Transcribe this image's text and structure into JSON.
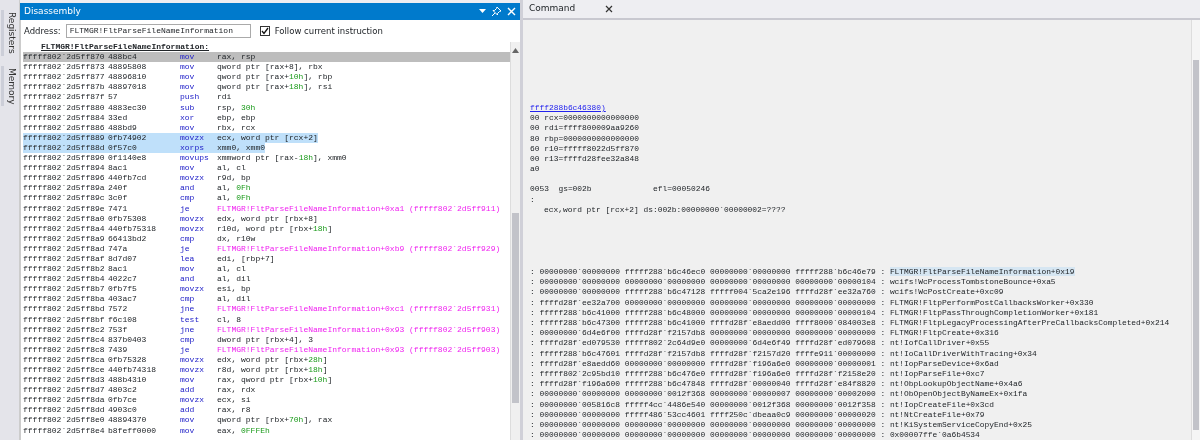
{
  "side_tabs": [
    {
      "label": "Registers"
    },
    {
      "label": "Memory"
    }
  ],
  "disassembly": {
    "title": "Disassembly",
    "address_label": "Address:",
    "address": "FLTMGR!FltParseFileNameInformation",
    "follow": {
      "label": "Follow current instruction",
      "checked": true
    },
    "function_header": "FLTMGR!FltParseFileNameInformation:",
    "rows": [
      {
        "address": "fffff802`2d5ff870",
        "bytes": "488bc4",
        "mnemonic": "mov",
        "operands": [
          "rax, rsp"
        ],
        "kind": "op",
        "current": true,
        "selected": false
      },
      {
        "address": "fffff802`2d5ff873",
        "bytes": "48895808",
        "mnemonic": "mov",
        "operands": [
          "qword ptr [rax+8], rbx"
        ],
        "kind": "op",
        "current": false,
        "selected": false
      },
      {
        "address": "fffff802`2d5ff877",
        "bytes": "48896810",
        "mnemonic": "mov",
        "operands": [
          "qword ptr [rax+",
          "10h",
          "], rbp"
        ],
        "kind": "op",
        "current": false,
        "selected": false
      },
      {
        "address": "fffff802`2d5ff87b",
        "bytes": "48897018",
        "mnemonic": "mov",
        "operands": [
          "qword ptr [rax+",
          "18h",
          "], rsi"
        ],
        "kind": "op",
        "current": false,
        "selected": false
      },
      {
        "address": "fffff802`2d5ff87f",
        "bytes": "57",
        "mnemonic": "push",
        "operands": [
          "rdi"
        ],
        "kind": "op",
        "current": false,
        "selected": false
      },
      {
        "address": "fffff802`2d5ff880",
        "bytes": "4883ec30",
        "mnemonic": "sub",
        "operands": [
          "rsp, ",
          "30h"
        ],
        "kind": "op",
        "current": false,
        "selected": false
      },
      {
        "address": "fffff802`2d5ff884",
        "bytes": "33ed",
        "mnemonic": "xor",
        "operands": [
          "ebp, ebp"
        ],
        "kind": "op",
        "current": false,
        "selected": false
      },
      {
        "address": "fffff802`2d5ff886",
        "bytes": "488bd9",
        "mnemonic": "mov",
        "operands": [
          "rbx, rcx"
        ],
        "kind": "op",
        "current": false,
        "selected": false
      },
      {
        "address": "fffff802`2d5ff889",
        "bytes": "0fb74902",
        "mnemonic": "movzx",
        "operands": [
          "ecx, word ptr [rcx+2]"
        ],
        "kind": "op",
        "current": false,
        "selected": true
      },
      {
        "address": "fffff802`2d5ff88d",
        "bytes": "0f57c0",
        "mnemonic": "xorps",
        "operands": [
          "xmm0, xmm0"
        ],
        "kind": "op",
        "current": false,
        "selected": true
      },
      {
        "address": "fffff802`2d5ff890",
        "bytes": "0f1140e8",
        "mnemonic": "movups",
        "operands": [
          "xmmword ptr [rax-",
          "18h",
          "], xmm0"
        ],
        "kind": "op",
        "current": false,
        "selected": false
      },
      {
        "address": "fffff802`2d5ff894",
        "bytes": "8ac1",
        "mnemonic": "mov",
        "operands": [
          "al, cl"
        ],
        "kind": "op",
        "current": false,
        "selected": false
      },
      {
        "address": "fffff802`2d5ff896",
        "bytes": "440fb7cd",
        "mnemonic": "movzx",
        "operands": [
          "r9d, bp"
        ],
        "kind": "op",
        "current": false,
        "selected": false
      },
      {
        "address": "fffff802`2d5ff89a",
        "bytes": "240f",
        "mnemonic": "and",
        "operands": [
          "al, ",
          "0Fh"
        ],
        "kind": "op",
        "current": false,
        "selected": false
      },
      {
        "address": "fffff802`2d5ff89c",
        "bytes": "3c0f",
        "mnemonic": "cmp",
        "operands": [
          "al, ",
          "0Fh"
        ],
        "kind": "op",
        "current": false,
        "selected": false
      },
      {
        "address": "fffff802`2d5ff89e",
        "bytes": "7471",
        "mnemonic": "je",
        "operands": [
          "FLTMGR!FltParseFileNameInformation+0xa1 (fffff802`2d5ff911)"
        ],
        "kind": "branch",
        "current": false,
        "selected": false
      },
      {
        "address": "fffff802`2d5ff8a0",
        "bytes": "0fb75308",
        "mnemonic": "movzx",
        "operands": [
          "edx, word ptr [rbx+8]"
        ],
        "kind": "op",
        "current": false,
        "selected": false
      },
      {
        "address": "fffff802`2d5ff8a4",
        "bytes": "440fb75318",
        "mnemonic": "movzx",
        "operands": [
          "r10d, word ptr [rbx+",
          "18h",
          "]"
        ],
        "kind": "op",
        "current": false,
        "selected": false
      },
      {
        "address": "fffff802`2d5ff8a9",
        "bytes": "66413bd2",
        "mnemonic": "cmp",
        "operands": [
          "dx, r10w"
        ],
        "kind": "op",
        "current": false,
        "selected": false
      },
      {
        "address": "fffff802`2d5ff8ad",
        "bytes": "747a",
        "mnemonic": "je",
        "operands": [
          "FLTMGR!FltParseFileNameInformation+0xb9 (fffff802`2d5ff929)"
        ],
        "kind": "branch",
        "current": false,
        "selected": false
      },
      {
        "address": "fffff802`2d5ff8af",
        "bytes": "8d7d07",
        "mnemonic": "lea",
        "operands": [
          "edi, [rbp+7]"
        ],
        "kind": "op",
        "current": false,
        "selected": false
      },
      {
        "address": "fffff802`2d5ff8b2",
        "bytes": "8ac1",
        "mnemonic": "mov",
        "operands": [
          "al, cl"
        ],
        "kind": "op",
        "current": false,
        "selected": false
      },
      {
        "address": "fffff802`2d5ff8b4",
        "bytes": "4022c7",
        "mnemonic": "and",
        "operands": [
          "al, dil"
        ],
        "kind": "op",
        "current": false,
        "selected": false
      },
      {
        "address": "fffff802`2d5ff8b7",
        "bytes": "0fb7f5",
        "mnemonic": "movzx",
        "operands": [
          "esi, bp"
        ],
        "kind": "op",
        "current": false,
        "selected": false
      },
      {
        "address": "fffff802`2d5ff8ba",
        "bytes": "403ac7",
        "mnemonic": "cmp",
        "operands": [
          "al, dil"
        ],
        "kind": "op",
        "current": false,
        "selected": false
      },
      {
        "address": "fffff802`2d5ff8bd",
        "bytes": "7572",
        "mnemonic": "jne",
        "operands": [
          "FLTMGR!FltParseFileNameInformation+0xc1 (fffff802`2d5ff931)"
        ],
        "kind": "branch",
        "current": false,
        "selected": false
      },
      {
        "address": "fffff802`2d5ff8bf",
        "bytes": "f6c108",
        "mnemonic": "test",
        "operands": [
          "cl, 8"
        ],
        "kind": "op",
        "current": false,
        "selected": false
      },
      {
        "address": "fffff802`2d5ff8c2",
        "bytes": "753f",
        "mnemonic": "jne",
        "operands": [
          "FLTMGR!FltParseFileNameInformation+0x93 (fffff802`2d5ff903)"
        ],
        "kind": "branch",
        "current": false,
        "selected": false
      },
      {
        "address": "fffff802`2d5ff8c4",
        "bytes": "837b0403",
        "mnemonic": "cmp",
        "operands": [
          "dword ptr [rbx+4], 3"
        ],
        "kind": "op",
        "current": false,
        "selected": false
      },
      {
        "address": "fffff802`2d5ff8c8",
        "bytes": "7439",
        "mnemonic": "je",
        "operands": [
          "FLTMGR!FltParseFileNameInformation+0x93 (fffff802`2d5ff903)"
        ],
        "kind": "branch",
        "current": false,
        "selected": false
      },
      {
        "address": "fffff802`2d5ff8ca",
        "bytes": "0fb75328",
        "mnemonic": "movzx",
        "operands": [
          "edx, word ptr [rbx+",
          "28h",
          "]"
        ],
        "kind": "op",
        "current": false,
        "selected": false
      },
      {
        "address": "fffff802`2d5ff8ce",
        "bytes": "440fb74318",
        "mnemonic": "movzx",
        "operands": [
          "r8d, word ptr [rbx+",
          "18h",
          "]"
        ],
        "kind": "op",
        "current": false,
        "selected": false
      },
      {
        "address": "fffff802`2d5ff8d3",
        "bytes": "488b4310",
        "mnemonic": "mov",
        "operands": [
          "rax, qword ptr [rbx+",
          "10h",
          "]"
        ],
        "kind": "op",
        "current": false,
        "selected": false
      },
      {
        "address": "fffff802`2d5ff8d7",
        "bytes": "4803c2",
        "mnemonic": "add",
        "operands": [
          "rax, rdx"
        ],
        "kind": "op",
        "current": false,
        "selected": false
      },
      {
        "address": "fffff802`2d5ff8da",
        "bytes": "0fb7ce",
        "mnemonic": "movzx",
        "operands": [
          "ecx, si"
        ],
        "kind": "op",
        "current": false,
        "selected": false
      },
      {
        "address": "fffff802`2d5ff8dd",
        "bytes": "4903c0",
        "mnemonic": "add",
        "operands": [
          "rax, r8"
        ],
        "kind": "op",
        "current": false,
        "selected": false
      },
      {
        "address": "fffff802`2d5ff8e0",
        "bytes": "48894370",
        "mnemonic": "mov",
        "operands": [
          "qword ptr [rbx+",
          "70h",
          "], rax"
        ],
        "kind": "op",
        "current": false,
        "selected": false
      },
      {
        "address": "fffff802`2d5ff8e4",
        "bytes": "b8feff0000",
        "mnemonic": "mov",
        "operands": [
          "eax, ",
          "0FFFEh"
        ],
        "kind": "op",
        "current": false,
        "selected": false
      }
    ]
  },
  "command": {
    "tab": "Command",
    "register_lines": [
      {
        "text": "ffff288b6c46380)",
        "kind": "link"
      },
      {
        "text": "00 rcx=0000000000000000",
        "kind": "plain"
      },
      {
        "text": "00 rdi=ffff800009aa9260",
        "kind": "plain"
      },
      {
        "text": "80 rbp=0000000000000000",
        "kind": "plain"
      },
      {
        "text": "60 r10=fffff8022d5ff870",
        "kind": "plain"
      },
      {
        "text": "00 r13=ffffd28fee32a848",
        "kind": "plain"
      },
      {
        "text": "a0",
        "kind": "plain"
      }
    ],
    "status_lines": [
      {
        "text": "0053  gs=002b             efl=00050246",
        "kind": "plain"
      },
      {
        "text": ":",
        "kind": "plain"
      },
      {
        "text": "ecx,word ptr [rcx+2] ds:002b:00000000`00000002=????",
        "kind": "indented"
      }
    ],
    "stack": [
      {
        "args": ": 00000000`00000000 fffff288`b6c46ec0 00000000`00000000 fffff288`b6c46e79 :",
        "symbol": "FLTMGR!FltParseFileNameInformation+0x19",
        "selected": true
      },
      {
        "args": ": 00000000`00000000 00000000`00000000 00000000`00000000 00000000`00000104 :",
        "symbol": "wcifs!WcProcessTombstoneBounce+0xa5",
        "selected": false
      },
      {
        "args": ": 00000000`00000000 fffff288`b6c47128 fffff004`5ca2e196 ffffd28f`ee32a760 :",
        "symbol": "wcifs!WcPostCreate+0xc09",
        "selected": false
      },
      {
        "args": ": ffffd28f`ee32a700 00000000`00000000 00000000`00000000 00000000`00000000 :",
        "symbol": "FLTMGR!FltpPerformPostCallbacksWorker+0x330",
        "selected": false
      },
      {
        "args": ": fffff288`b6c41000 fffff288`b6c48000 00000000`00000000 00000000`00000104 :",
        "symbol": "FLTMGR!FltpPassThroughCompletionWorker+0x181",
        "selected": false
      },
      {
        "args": ": fffff288`b6c47300 fffff288`b6c41000 ffffd28f`e8aedd00 ffff8000`084003e8 :",
        "symbol": "FLTMGR!FltpLegacyProcessingAfterPreCallbacksCompleted+0x214",
        "selected": false
      },
      {
        "args": ": 00000000`6d4e6f00 ffffd28f`f2157db8 00000000`00000000 00000000`00000000 :",
        "symbol": "FLTMGR!FltpCreate+0x316",
        "selected": false
      },
      {
        "args": ": ffffd28f`ed079530 fffff802`2c64d9e0 00000000`6d4e6f49 ffffd28f`ed079608 :",
        "symbol": "nt!IofCallDriver+0x55",
        "selected": false
      },
      {
        "args": ": fffff288`b6c47601 ffffd28f`f2157db8 ffffd28f`f2157d20 ffffe911`00000000 :",
        "symbol": "nt!IoCallDriverWithTracing+0x34",
        "selected": false
      },
      {
        "args": ": ffffd28f`e8aedd60 00000000`00000000 ffffd28f`f196a6e0 00000000`00000001 :",
        "symbol": "nt!IopParseDevice+0x6ad",
        "selected": false
      },
      {
        "args": ": fffff802`2c95bd10 fffff288`b6c476e0 ffffd28f`f196a6e0 ffffd28f`f2158e20 :",
        "symbol": "nt!IopParseFile+0xc7",
        "selected": false
      },
      {
        "args": ": ffffd28f`f196a600 fffff288`b6c47848 ffffd28f`00000040 ffffd28f`e84f8820 :",
        "symbol": "nt!ObpLookupObjectName+0x4a6",
        "selected": false
      },
      {
        "args": ": 00000000`00000000 00000000`0012f368 00000000`00000007 00000000`00002000 :",
        "symbol": "nt!ObOpenObjectByNameEx+0x1fa",
        "selected": false
      },
      {
        "args": ": 00000000`005816c8 fffff4cc`4486e540 00000000`0012f368 00000000`0012f358 :",
        "symbol": "nt!IopCreateFile+0x3cd",
        "selected": false
      },
      {
        "args": ": 00000000`00000000 fffff486`53cc4601 ffff250c`dbeaa0c9 00000000`00000020 :",
        "symbol": "nt!NtCreateFile+0x79",
        "selected": false
      },
      {
        "args": ": 00000000`00000000 00000000`00000000 00000000`00000000 00000000`00000000 :",
        "symbol": "nt!KiSystemServiceCopyEnd+0x25",
        "selected": false
      },
      {
        "args": ": 00000000`00000000 00000000`00000000 00000000`00000000 00000000`00000000 :",
        "symbol": "0x00007ffe`0a6b4534",
        "selected": false
      }
    ]
  }
}
